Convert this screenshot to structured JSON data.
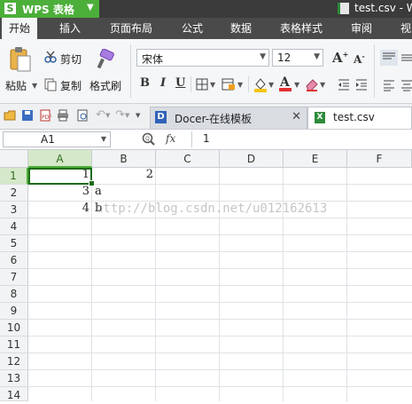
{
  "window": {
    "app_name": "WPS 表格",
    "doc_title": "test.csv - W"
  },
  "menu": {
    "tabs": [
      "开始",
      "插入",
      "页面布局",
      "公式",
      "数据",
      "表格样式",
      "审阅",
      "视"
    ]
  },
  "ribbon": {
    "paste": "粘贴",
    "cut": "剪切",
    "copy": "复制",
    "format_painter": "格式刷",
    "font_name": "宋体",
    "font_size": "12",
    "bold": "B",
    "italic": "I",
    "underline": "U",
    "grow_font": "A",
    "shrink_font": "A",
    "font_color": "#e03030",
    "fill_color": "#f5c518"
  },
  "doc_tabs": [
    {
      "label": "Docer-在线模板"
    },
    {
      "label": "test.csv"
    }
  ],
  "formula_bar": {
    "name_box": "A1",
    "fx": "fx",
    "value": "1"
  },
  "sheet": {
    "columns": [
      "A",
      "B",
      "C",
      "D",
      "E",
      "F"
    ],
    "rows": [
      "1",
      "2",
      "3",
      "4",
      "5",
      "6",
      "7",
      "8",
      "9",
      "10",
      "11",
      "12",
      "13",
      "14"
    ],
    "active_cell": "A1",
    "cells": {
      "A1": "1",
      "B1": "2",
      "A2": "3",
      "B2": "a",
      "A3": "4",
      "B3": "b"
    }
  },
  "watermark": "http://blog.csdn.net/u012162613"
}
